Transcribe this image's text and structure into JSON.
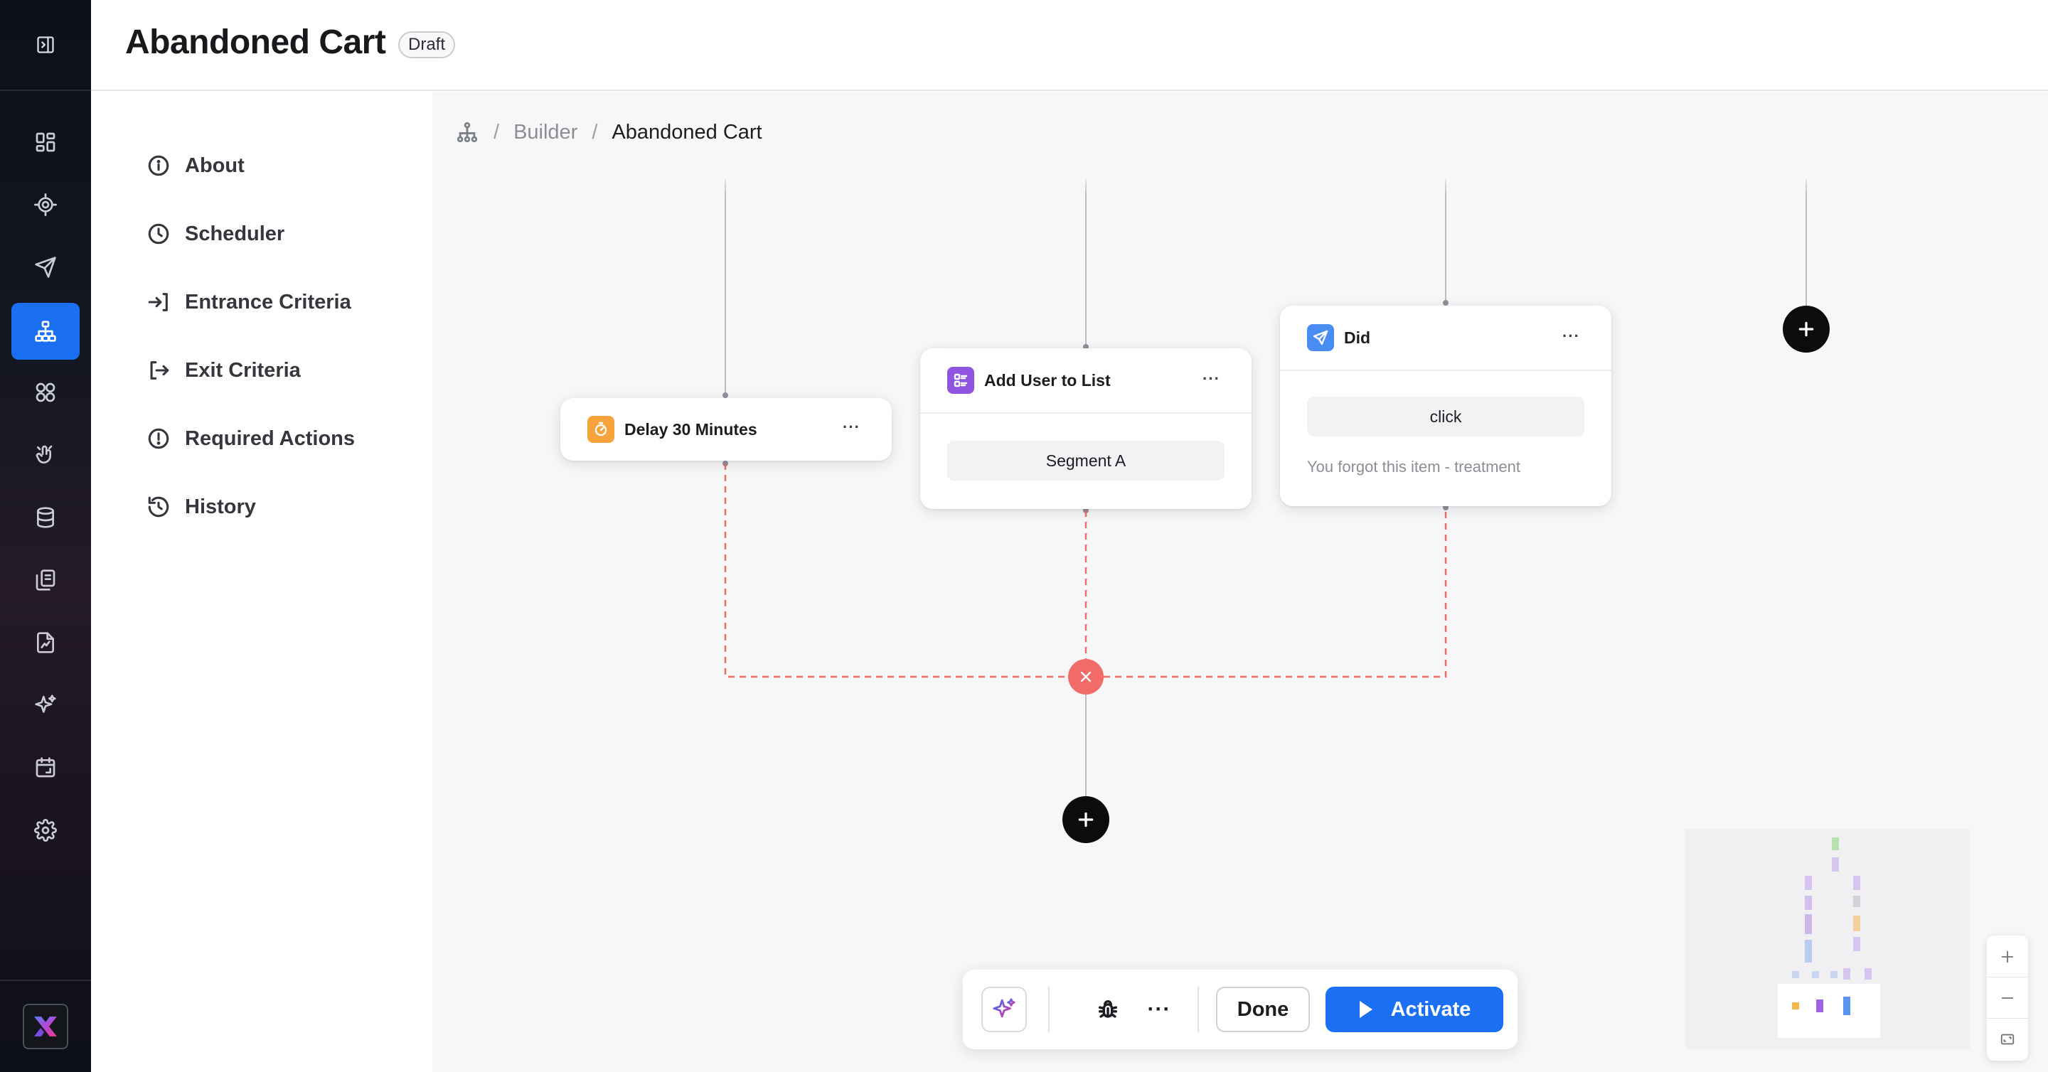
{
  "header": {
    "title": "Abandoned Cart",
    "status_badge": "Draft"
  },
  "rail": {
    "items": [
      {
        "icon": "dashboard-icon"
      },
      {
        "icon": "target-icon"
      },
      {
        "icon": "send-icon"
      },
      {
        "icon": "journeys-icon",
        "active": true
      },
      {
        "icon": "segments-icon"
      },
      {
        "icon": "triggers-icon"
      },
      {
        "icon": "database-icon"
      },
      {
        "icon": "templates-icon"
      },
      {
        "icon": "reports-icon"
      },
      {
        "icon": "ai-sparkle-icon"
      },
      {
        "icon": "calendar-icon"
      },
      {
        "icon": "settings-icon"
      }
    ],
    "accent_color": "#1a6ff2"
  },
  "menu": {
    "items": [
      {
        "label": "About",
        "icon": "info-icon"
      },
      {
        "label": "Scheduler",
        "icon": "clock-icon"
      },
      {
        "label": "Entrance Criteria",
        "icon": "entrance-icon"
      },
      {
        "label": "Exit Criteria",
        "icon": "exit-icon"
      },
      {
        "label": "Required Actions",
        "icon": "alert-icon"
      },
      {
        "label": "History",
        "icon": "history-icon"
      }
    ]
  },
  "breadcrumb": {
    "items": [
      "Builder",
      "Abandoned Cart"
    ]
  },
  "nodes": {
    "delay": {
      "title": "Delay 30 Minutes",
      "icon": "timer-icon",
      "color": "#f7a33b",
      "more": "···"
    },
    "add_user": {
      "title": "Add User to List",
      "icon": "list-icon",
      "color": "#8f55e0",
      "more": "···",
      "value": "Segment A"
    },
    "did": {
      "title": "Did",
      "icon": "send-icon",
      "color": "#4a8df2",
      "more": "···",
      "value": "click",
      "note": "You forgot this item - treatment"
    }
  },
  "connector_error_color": "#f26b6b",
  "toolbar": {
    "more": "···",
    "done_label": "Done",
    "activate_label": "Activate"
  }
}
